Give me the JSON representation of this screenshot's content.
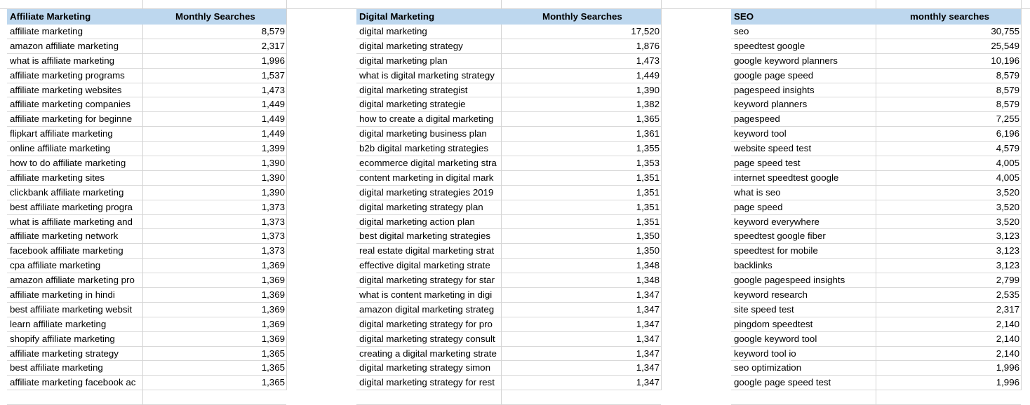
{
  "tables": [
    {
      "title": "Affiliate Marketing",
      "metric_header": "Monthly Searches",
      "rows": [
        {
          "keyword": "affiliate marketing",
          "searches": "8,579"
        },
        {
          "keyword": "amazon affiliate marketing",
          "searches": "2,317"
        },
        {
          "keyword": "what is affiliate marketing",
          "searches": "1,996"
        },
        {
          "keyword": "affiliate marketing programs",
          "searches": "1,537"
        },
        {
          "keyword": "affiliate marketing websites",
          "searches": "1,473"
        },
        {
          "keyword": "affiliate marketing companies",
          "searches": "1,449"
        },
        {
          "keyword": "affiliate marketing for beginne",
          "searches": "1,449"
        },
        {
          "keyword": "flipkart affiliate marketing",
          "searches": "1,449"
        },
        {
          "keyword": "online affiliate marketing",
          "searches": "1,399"
        },
        {
          "keyword": "how to do affiliate marketing",
          "searches": "1,390"
        },
        {
          "keyword": "affiliate marketing sites",
          "searches": "1,390"
        },
        {
          "keyword": "clickbank affiliate marketing",
          "searches": "1,390"
        },
        {
          "keyword": "best affiliate marketing progra",
          "searches": "1,373"
        },
        {
          "keyword": "what is affiliate marketing and",
          "searches": "1,373"
        },
        {
          "keyword": "affiliate marketing network",
          "searches": "1,373"
        },
        {
          "keyword": "facebook affiliate marketing",
          "searches": "1,373"
        },
        {
          "keyword": "cpa affiliate marketing",
          "searches": "1,369"
        },
        {
          "keyword": "amazon affiliate marketing pro",
          "searches": "1,369"
        },
        {
          "keyword": "affiliate marketing in hindi",
          "searches": "1,369"
        },
        {
          "keyword": "best affiliate marketing websit",
          "searches": "1,369"
        },
        {
          "keyword": "learn affiliate marketing",
          "searches": "1,369"
        },
        {
          "keyword": "shopify affiliate marketing",
          "searches": "1,369"
        },
        {
          "keyword": "affiliate marketing strategy",
          "searches": "1,365"
        },
        {
          "keyword": "best affiliate marketing",
          "searches": "1,365"
        },
        {
          "keyword": "affiliate marketing facebook ac",
          "searches": "1,365"
        }
      ]
    },
    {
      "title": "Digital Marketing",
      "metric_header": "Monthly Searches",
      "rows": [
        {
          "keyword": "digital marketing",
          "searches": "17,520"
        },
        {
          "keyword": "digital marketing strategy",
          "searches": "1,876"
        },
        {
          "keyword": "digital marketing plan",
          "searches": "1,473"
        },
        {
          "keyword": "what is digital marketing strategy",
          "searches": "1,449"
        },
        {
          "keyword": "digital marketing strategist",
          "searches": "1,390"
        },
        {
          "keyword": "digital marketing strategie",
          "searches": "1,382"
        },
        {
          "keyword": "how to create a digital marketing",
          "searches": "1,365"
        },
        {
          "keyword": "digital marketing business plan",
          "searches": "1,361"
        },
        {
          "keyword": "b2b digital marketing strategies",
          "searches": "1,355"
        },
        {
          "keyword": "ecommerce digital marketing stra",
          "searches": "1,353"
        },
        {
          "keyword": "content marketing in digital mark",
          "searches": "1,351"
        },
        {
          "keyword": "digital marketing strategies 2019",
          "searches": "1,351"
        },
        {
          "keyword": "digital marketing strategy plan",
          "searches": "1,351"
        },
        {
          "keyword": "digital marketing action plan",
          "searches": "1,351"
        },
        {
          "keyword": "best digital marketing strategies",
          "searches": "1,350"
        },
        {
          "keyword": "real estate digital marketing strat",
          "searches": "1,350"
        },
        {
          "keyword": "effective digital marketing strate",
          "searches": "1,348"
        },
        {
          "keyword": "digital marketing strategy for star",
          "searches": "1,348"
        },
        {
          "keyword": "what is content marketing in digi",
          "searches": "1,347"
        },
        {
          "keyword": "amazon digital marketing strateg",
          "searches": "1,347"
        },
        {
          "keyword": "digital marketing strategy for pro",
          "searches": "1,347"
        },
        {
          "keyword": "digital marketing strategy consult",
          "searches": "1,347"
        },
        {
          "keyword": "creating a digital marketing strate",
          "searches": "1,347"
        },
        {
          "keyword": "digital marketing strategy simon",
          "searches": "1,347"
        },
        {
          "keyword": "digital marketing strategy for rest",
          "searches": "1,347"
        }
      ]
    },
    {
      "title": "SEO",
      "metric_header": "monthly searches",
      "rows": [
        {
          "keyword": "seo",
          "searches": "30,755"
        },
        {
          "keyword": "speedtest google",
          "searches": "25,549"
        },
        {
          "keyword": "google keyword planners",
          "searches": "10,196"
        },
        {
          "keyword": "google page speed",
          "searches": "8,579"
        },
        {
          "keyword": "pagespeed insights",
          "searches": "8,579"
        },
        {
          "keyword": "keyword planners",
          "searches": "8,579"
        },
        {
          "keyword": "pagespeed",
          "searches": "7,255"
        },
        {
          "keyword": "keyword tool",
          "searches": "6,196"
        },
        {
          "keyword": "website speed test",
          "searches": "4,579"
        },
        {
          "keyword": "page speed test",
          "searches": "4,005"
        },
        {
          "keyword": "internet speedtest google",
          "searches": "4,005"
        },
        {
          "keyword": "what is seo",
          "searches": "3,520"
        },
        {
          "keyword": "page speed",
          "searches": "3,520"
        },
        {
          "keyword": "keyword everywhere",
          "searches": "3,520"
        },
        {
          "keyword": "speedtest google fiber",
          "searches": "3,123"
        },
        {
          "keyword": "speedtest for mobile",
          "searches": "3,123"
        },
        {
          "keyword": "backlinks",
          "searches": "3,123"
        },
        {
          "keyword": "google pagespeed insights",
          "searches": "2,799"
        },
        {
          "keyword": "keyword research",
          "searches": "2,535"
        },
        {
          "keyword": "site speed test",
          "searches": "2,317"
        },
        {
          "keyword": "pingdom speedtest",
          "searches": "2,140"
        },
        {
          "keyword": "google keyword tool",
          "searches": "2,140"
        },
        {
          "keyword": "keyword tool io",
          "searches": "2,140"
        },
        {
          "keyword": "seo optimization",
          "searches": "1,996"
        },
        {
          "keyword": "google page speed test",
          "searches": "1,996"
        }
      ]
    }
  ]
}
